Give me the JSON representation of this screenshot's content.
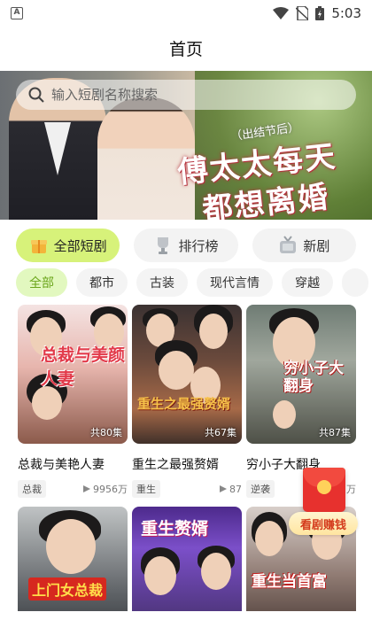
{
  "status_bar": {
    "time": "5:03",
    "app_indicator": "A"
  },
  "header": {
    "title": "首页"
  },
  "banner": {
    "search_placeholder": "输入短剧名称搜索",
    "title_line1": "傅太太每天",
    "title_line2": "都想离婚",
    "tag_text": "（出结节后）"
  },
  "categories": [
    {
      "label": "全部短剧",
      "icon": "gift-box-icon",
      "active": true
    },
    {
      "label": "排行榜",
      "icon": "trophy-icon",
      "active": false
    },
    {
      "label": "新剧",
      "icon": "tv-icon",
      "active": false
    }
  ],
  "filters": [
    "全部",
    "都市",
    "古装",
    "现代言情",
    "穿越",
    ""
  ],
  "cards": [
    {
      "title": "总裁与美艳人妻",
      "poster_title": "总裁与美颜人妻",
      "tag": "总裁",
      "views": "9956万",
      "episodes": "共80集"
    },
    {
      "title": "重生之最强赘婿",
      "poster_title": "重生之最强赘婿",
      "tag": "重生",
      "views": "87",
      "episodes": "共67集"
    },
    {
      "title": "穷小子大翻身",
      "poster_title": "穷小子大翻身",
      "tag": "逆袭",
      "views": "万",
      "episodes": "共87集"
    },
    {
      "title": "",
      "poster_title": "上门女总裁",
      "tag": "",
      "views": "",
      "episodes": ""
    },
    {
      "title": "",
      "poster_title": "重生赘婿",
      "tag": "",
      "views": "",
      "episodes": ""
    },
    {
      "title": "",
      "poster_title": "重生当首富",
      "tag": "",
      "views": "",
      "episodes": ""
    }
  ],
  "float_reward": {
    "label": "看剧赚钱"
  },
  "colors": {
    "accent_green": "#d7f27a",
    "active_chip_text": "#6aa51a",
    "reward_red": "#e7312e"
  }
}
